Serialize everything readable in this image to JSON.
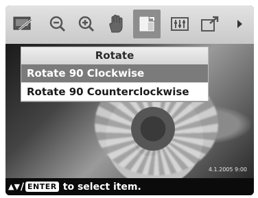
{
  "toolbar": {
    "icons": [
      {
        "name": "edit-icon"
      },
      {
        "name": "zoom-out-icon"
      },
      {
        "name": "zoom-in-icon"
      },
      {
        "name": "hand-pan-icon"
      },
      {
        "name": "rotate-icon",
        "selected": true
      },
      {
        "name": "adjust-levels-icon"
      },
      {
        "name": "export-icon"
      },
      {
        "name": "more-right-arrow-icon"
      }
    ]
  },
  "menu": {
    "title": "Rotate",
    "items": [
      {
        "label": "Rotate 90 Clockwise",
        "highlighted": true
      },
      {
        "label": "Rotate 90 Counterclockwise",
        "highlighted": false
      }
    ]
  },
  "photo": {
    "date": "4.1.2005 9:00"
  },
  "status": {
    "arrows": "▲▼",
    "separator": "/",
    "enter_key": "ENTER",
    "instruction": "to select item."
  },
  "colors": {
    "highlight": "#7b7b7b",
    "selected_tool": "#8d8d8d",
    "toolbar_bg": "#d4d4d4",
    "screen_bg": "#0b0b0b"
  }
}
